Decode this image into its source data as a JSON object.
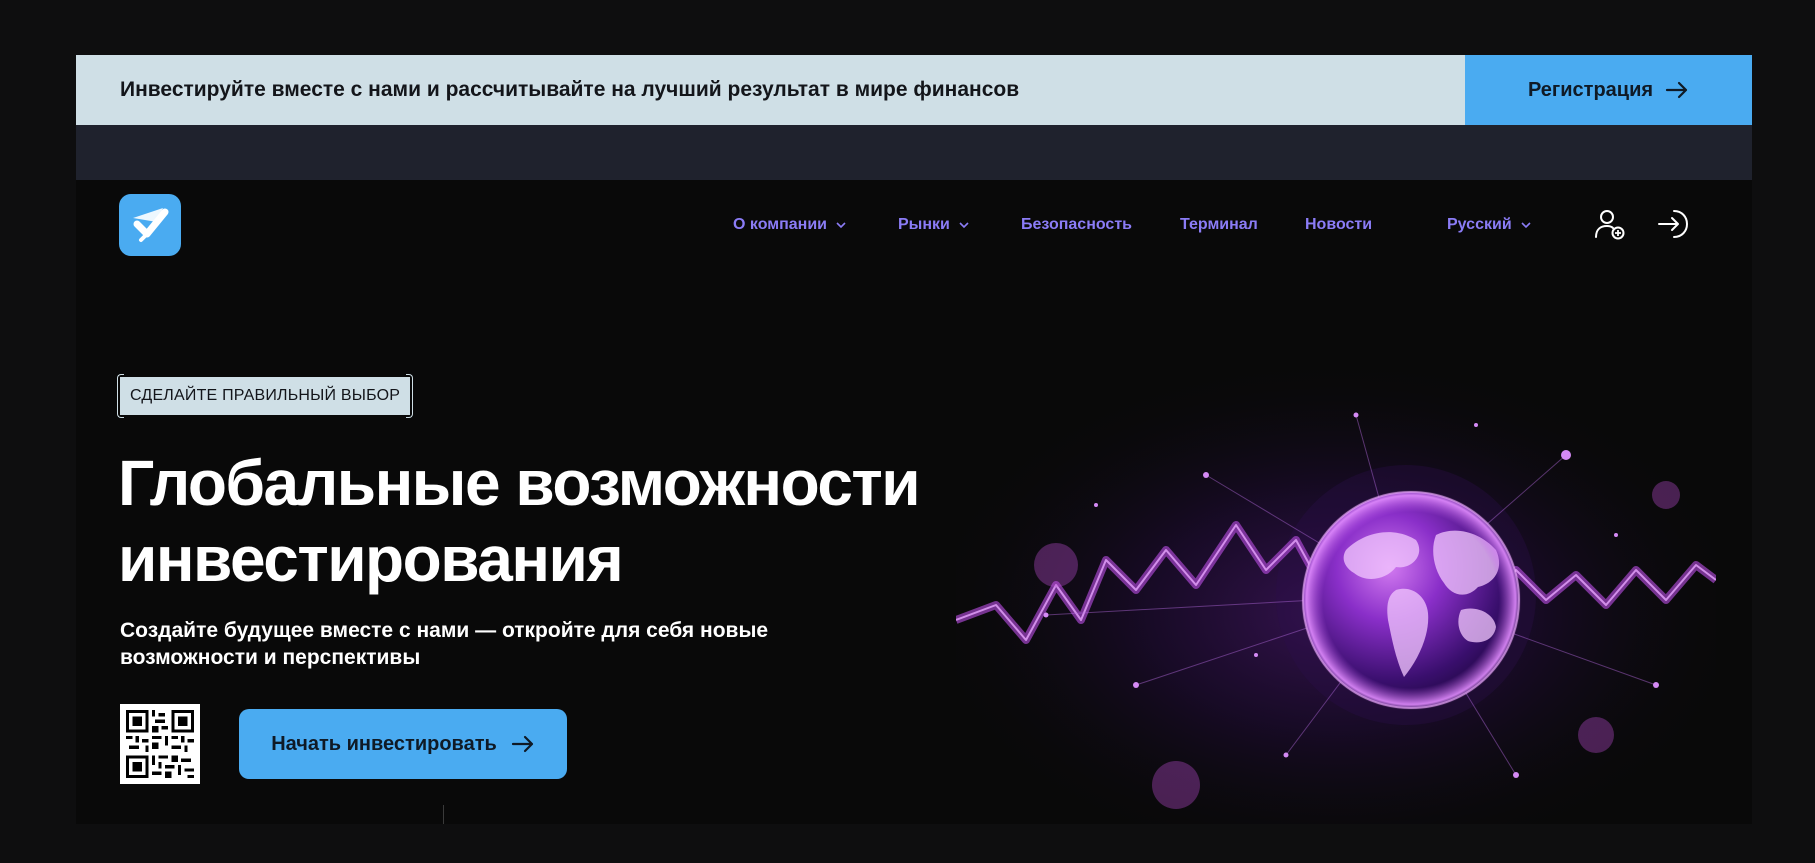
{
  "promo": {
    "text": "Инвестируйте вместе с нами и рассчитывайте на лучший результат в мире финансов",
    "register_label": "Регистрация"
  },
  "nav": {
    "items": [
      {
        "label": "О компании",
        "has_dropdown": true
      },
      {
        "label": "Рынки",
        "has_dropdown": true
      },
      {
        "label": "Безопасность",
        "has_dropdown": false
      },
      {
        "label": "Терминал",
        "has_dropdown": false
      },
      {
        "label": "Новости",
        "has_dropdown": false
      }
    ],
    "language": "Русский"
  },
  "hero": {
    "badge": "СДЕЛАЙТЕ ПРАВИЛЬНЫЙ ВЫБОР",
    "title_line1": "Глобальные возможности",
    "title_line2": "инвестирования",
    "subtitle_line1": "Создайте будущее вместе с нами — откройте для себя новые",
    "subtitle_line2": "возможности и перспективы",
    "cta_label": "Начать инвестировать"
  },
  "icons": {
    "logo": "checkmark-logo-icon",
    "register_arrow": "arrow-right-icon",
    "signup": "user-plus-icon",
    "login": "login-arrow-icon",
    "dropdown": "chevron-down-icon",
    "qr": "qr-code-icon"
  },
  "colors": {
    "accent": "#4aabf1",
    "nav": "#8b7cf6",
    "promo_bg": "#cfdfe6",
    "strip_bg": "#1f222d",
    "page_bg": "#090909"
  }
}
